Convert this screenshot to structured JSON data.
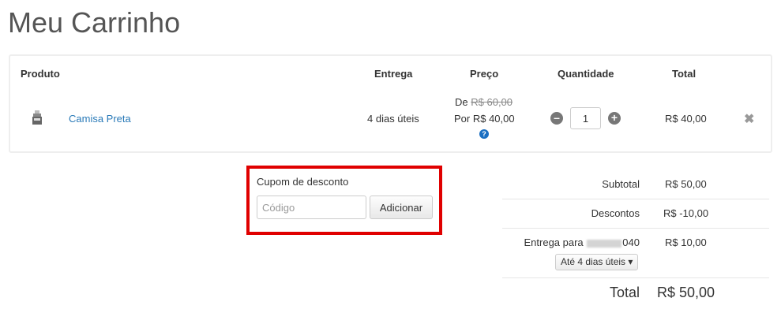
{
  "page": {
    "title": "Meu Carrinho"
  },
  "table": {
    "headers": {
      "produto": "Produto",
      "entrega": "Entrega",
      "preco": "Preço",
      "quantidade": "Quantidade",
      "total": "Total"
    },
    "item": {
      "name": "Camisa Preta",
      "delivery": "4 dias úteis",
      "price_from_prefix": "De",
      "price_old": "R$ 60,00",
      "price_now": "Por R$ 40,00",
      "help_icon": "?",
      "quantity": "1",
      "total": "R$ 40,00",
      "remove_icon": "✖"
    }
  },
  "coupon": {
    "label": "Cupom de desconto",
    "placeholder": "Código",
    "button": "Adicionar"
  },
  "summary": {
    "subtotal_label": "Subtotal",
    "subtotal_value": "R$ 50,00",
    "discount_label": "Descontos",
    "discount_value": "R$ -10,00",
    "shipping_label_prefix": "Entrega para",
    "shipping_cep_suffix": "040",
    "shipping_value": "R$ 10,00",
    "shipping_option": "Até 4 dias úteis ▾",
    "total_label": "Total",
    "total_value": "R$ 50,00"
  },
  "colors": {
    "highlight_border": "#e00000",
    "link": "#2a7ab8",
    "help_icon": "#1b6fc2"
  },
  "icons": {
    "minus": "minus-circle-icon",
    "plus": "plus-circle-icon",
    "remove": "close-icon",
    "help": "question-circle-icon"
  }
}
